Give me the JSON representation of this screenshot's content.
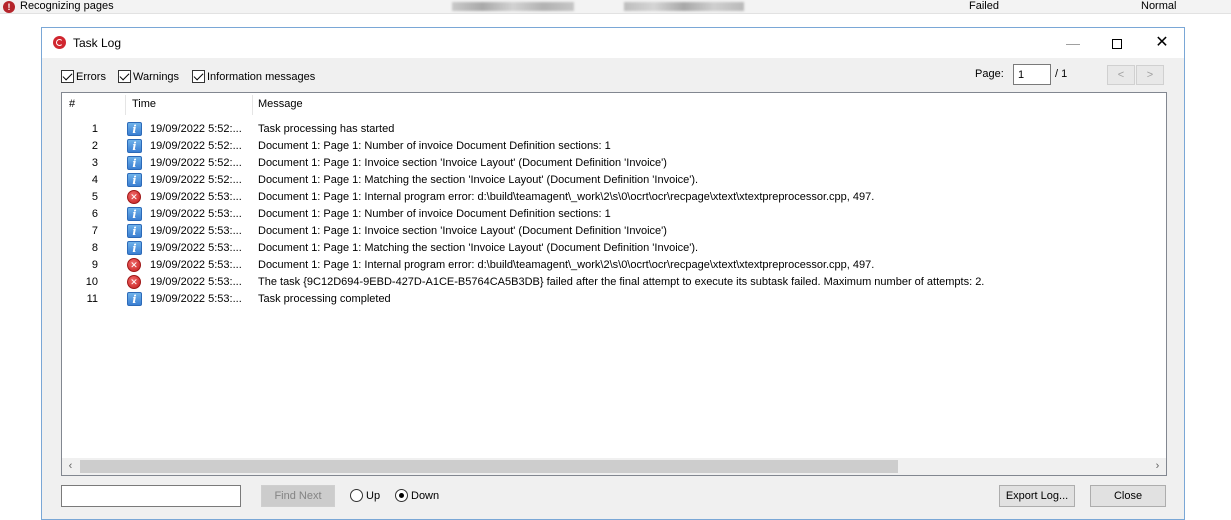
{
  "background": {
    "task_name": "Recognizing pages",
    "status": "Failed",
    "priority": "Normal"
  },
  "dialog": {
    "title": "Task Log",
    "window_controls": {
      "minimize": "—",
      "close": "✕"
    }
  },
  "filters": {
    "errors_label": "Errors",
    "warnings_label": "Warnings",
    "info_label": "Information messages",
    "errors_checked": true,
    "warnings_checked": true,
    "info_checked": true
  },
  "pager": {
    "label": "Page:",
    "current": "1",
    "total": "/ 1",
    "prev": "<",
    "next": ">"
  },
  "columns": {
    "num": "#",
    "time": "Time",
    "message": "Message"
  },
  "rows": [
    {
      "num": "1",
      "type": "info",
      "icon": "info-icon",
      "time": "19/09/2022 5:52:...",
      "message": "Task processing has started"
    },
    {
      "num": "2",
      "type": "info",
      "icon": "info-icon",
      "time": "19/09/2022 5:52:...",
      "message": "Document 1: Page 1: Number of invoice Document Definition sections: 1"
    },
    {
      "num": "3",
      "type": "info",
      "icon": "info-icon",
      "time": "19/09/2022 5:52:...",
      "message": "Document 1: Page 1: Invoice section 'Invoice Layout' (Document Definition 'Invoice')"
    },
    {
      "num": "4",
      "type": "info",
      "icon": "info-icon",
      "time": "19/09/2022 5:52:...",
      "message": "Document 1: Page 1: Matching the section 'Invoice Layout' (Document Definition 'Invoice')."
    },
    {
      "num": "5",
      "type": "error",
      "icon": "error-icon",
      "time": "19/09/2022 5:53:...",
      "message": "Document 1: Page 1: Internal program error: d:\\build\\teamagent\\_work\\2\\s\\0\\ocrt\\ocr\\recpage\\xtext\\xtextpreprocessor.cpp, 497."
    },
    {
      "num": "6",
      "type": "info",
      "icon": "info-icon",
      "time": "19/09/2022 5:53:...",
      "message": "Document 1: Page 1: Number of invoice Document Definition sections: 1"
    },
    {
      "num": "7",
      "type": "info",
      "icon": "info-icon",
      "time": "19/09/2022 5:53:...",
      "message": "Document 1: Page 1: Invoice section 'Invoice Layout' (Document Definition 'Invoice')"
    },
    {
      "num": "8",
      "type": "info",
      "icon": "info-icon",
      "time": "19/09/2022 5:53:...",
      "message": "Document 1: Page 1: Matching the section 'Invoice Layout' (Document Definition 'Invoice')."
    },
    {
      "num": "9",
      "type": "error",
      "icon": "error-icon",
      "time": "19/09/2022 5:53:...",
      "message": "Document 1: Page 1: Internal program error: d:\\build\\teamagent\\_work\\2\\s\\0\\ocrt\\ocr\\recpage\\xtext\\xtextpreprocessor.cpp, 497."
    },
    {
      "num": "10",
      "type": "error",
      "icon": "error-icon",
      "time": "19/09/2022 5:53:...",
      "message": "The task {9C12D694-9EBD-427D-A1CE-B5764CA5B3DB} failed after the final attempt to execute its subtask failed. Maximum number of attempts: 2."
    },
    {
      "num": "11",
      "type": "info",
      "icon": "info-icon",
      "time": "19/09/2022 5:53:...",
      "message": "Task processing completed"
    }
  ],
  "search": {
    "value": "",
    "find_next_label": "Find Next",
    "up_label": "Up",
    "down_label": "Down",
    "direction": "Down"
  },
  "buttons": {
    "export_label": "Export Log...",
    "close_label": "Close"
  }
}
